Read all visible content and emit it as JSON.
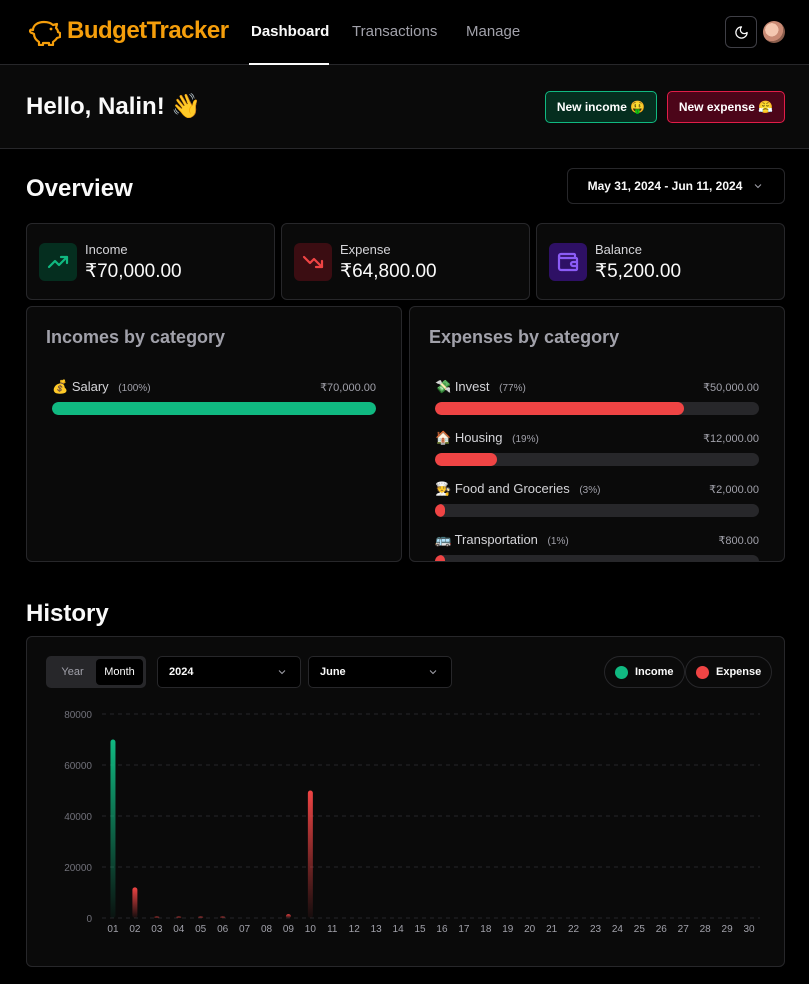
{
  "nav": {
    "brand": "BudgetTracker",
    "links": [
      "Dashboard",
      "Transactions",
      "Manage"
    ],
    "active": "Dashboard"
  },
  "greeting": {
    "text": "Hello, Nalin! 👋"
  },
  "actions": {
    "new_income": "New income 🤑",
    "new_expense": "New expense 😤"
  },
  "overview": {
    "title": "Overview",
    "date_range": "May 31, 2024 - Jun 11, 2024",
    "stats": [
      {
        "label": "Income",
        "value": "₹70,000.00",
        "icon": "trending-up-icon",
        "color": "#10b981"
      },
      {
        "label": "Expense",
        "value": "₹64,800.00",
        "icon": "trending-down-icon",
        "color": "#ef4444"
      },
      {
        "label": "Balance",
        "value": "₹5,200.00",
        "icon": "wallet-icon",
        "color": "#8b5cf6"
      }
    ]
  },
  "incomes": {
    "title": "Incomes by category",
    "items": [
      {
        "emoji": "💰",
        "name": "Salary",
        "pct": "(100%)",
        "amount": "₹70,000.00",
        "fraction": 1.0
      }
    ]
  },
  "expenses": {
    "title": "Expenses by category",
    "items": [
      {
        "emoji": "💸",
        "name": "Invest",
        "pct": "(77%)",
        "amount": "₹50,000.00",
        "fraction": 0.77
      },
      {
        "emoji": "🏠",
        "name": "Housing",
        "pct": "(19%)",
        "amount": "₹12,000.00",
        "fraction": 0.19
      },
      {
        "emoji": "🧑‍🍳",
        "name": "Food and Groceries",
        "pct": "(3%)",
        "amount": "₹2,000.00",
        "fraction": 0.03
      },
      {
        "emoji": "🚌",
        "name": "Transportation",
        "pct": "(1%)",
        "amount": "₹800.00",
        "fraction": 0.01
      }
    ]
  },
  "history": {
    "title": "History",
    "toggle": [
      "Year",
      "Month"
    ],
    "toggle_active": "Month",
    "year": "2024",
    "month": "June",
    "legend": [
      {
        "name": "Income",
        "color": "#10b981"
      },
      {
        "name": "Expense",
        "color": "#ef4444"
      }
    ]
  },
  "colors": {
    "income": "#10b981",
    "expense": "#ef4444",
    "balance": "#8b5cf6",
    "brand": "#f59e0b"
  },
  "chart_data": {
    "type": "bar",
    "categories": [
      "01",
      "02",
      "03",
      "04",
      "05",
      "06",
      "07",
      "08",
      "09",
      "10",
      "11",
      "12",
      "13",
      "14",
      "15",
      "16",
      "17",
      "18",
      "19",
      "20",
      "21",
      "22",
      "23",
      "24",
      "25",
      "26",
      "27",
      "28",
      "29",
      "30"
    ],
    "yticks": [
      "0",
      "20000",
      "40000",
      "60000",
      "80000"
    ],
    "ylim": [
      0,
      80000
    ],
    "grid": true,
    "series": [
      {
        "name": "Income",
        "values": [
          70000,
          0,
          0,
          0,
          0,
          0,
          0,
          0,
          0,
          0,
          0,
          0,
          0,
          0,
          0,
          0,
          0,
          0,
          0,
          0,
          0,
          0,
          0,
          0,
          0,
          0,
          0,
          0,
          0,
          0
        ]
      },
      {
        "name": "Expense",
        "values": [
          0,
          12000,
          300,
          300,
          300,
          300,
          0,
          0,
          1500,
          50000,
          0,
          0,
          0,
          0,
          0,
          0,
          0,
          0,
          0,
          0,
          0,
          0,
          0,
          0,
          0,
          0,
          0,
          0,
          0,
          0
        ]
      }
    ]
  }
}
